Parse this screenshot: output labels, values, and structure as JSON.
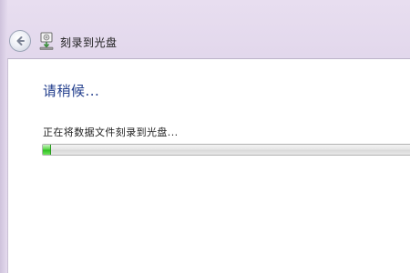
{
  "window": {
    "title": "刻录到光盘"
  },
  "icons": {
    "back": "back-arrow-icon",
    "app": "disc-burn-icon"
  },
  "main": {
    "heading": "请稍候...",
    "status_text": "正在将数据文件刻录到光盘...",
    "progress_fraction": 0.022
  },
  "colors": {
    "heading": "#213d8c",
    "progress_fill": "#3cc42c",
    "frame": "#e2d7ec"
  }
}
